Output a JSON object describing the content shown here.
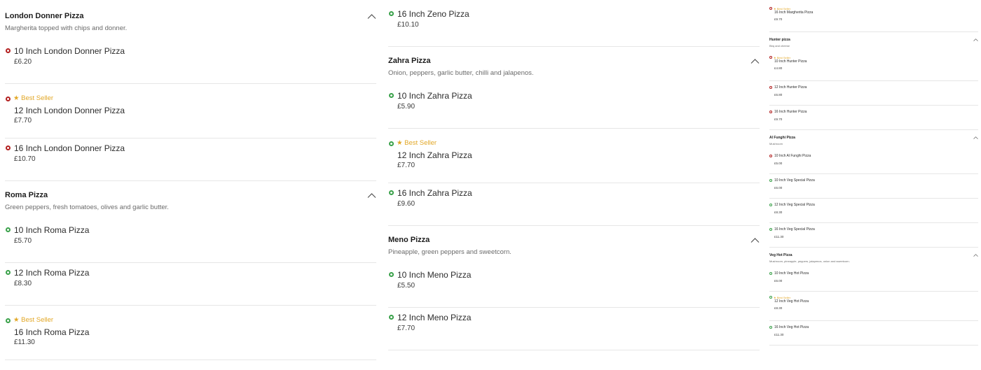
{
  "colors": {
    "veg": "#3aa14a",
    "nonveg": "#b32020",
    "bestseller": "#e2a726"
  },
  "columns": [
    [
      {
        "title": "London Donner Pizza",
        "desc": "Margherita topped with chips and donner.",
        "items": [
          {
            "name": "10 Inch London Donner Pizza",
            "price": "£6.20",
            "veg": false,
            "best": false
          },
          {
            "name": "12 Inch London Donner Pizza",
            "price": "£7.70",
            "veg": false,
            "best": true
          },
          {
            "name": "16 Inch London Donner Pizza",
            "price": "£10.70",
            "veg": false,
            "best": false
          }
        ]
      },
      {
        "title": "Roma Pizza",
        "desc": "Green peppers, fresh tomatoes, olives and garlic butter.",
        "items": [
          {
            "name": "10 Inch Roma Pizza",
            "price": "£5.70",
            "veg": true,
            "best": false
          },
          {
            "name": "12 Inch Roma Pizza",
            "price": "£8.30",
            "veg": true,
            "best": false
          },
          {
            "name": "16 Inch Roma Pizza",
            "price": "£11.30",
            "veg": true,
            "best": true
          }
        ]
      }
    ],
    [
      {
        "title": "",
        "desc": "",
        "items": [
          {
            "name": "16 Inch Zeno Pizza",
            "price": "£10.10",
            "veg": true,
            "best": false
          }
        ]
      },
      {
        "title": "Zahra Pizza",
        "desc": "Onion, peppers, garlic butter, chilli and jalapenos.",
        "items": [
          {
            "name": "10 Inch Zahra Pizza",
            "price": "£5.90",
            "veg": true,
            "best": false
          },
          {
            "name": "12 Inch Zahra Pizza",
            "price": "£7.70",
            "veg": true,
            "best": true
          },
          {
            "name": "16 Inch Zahra Pizza",
            "price": "£9.60",
            "veg": true,
            "best": false
          }
        ]
      },
      {
        "title": "Meno Pizza",
        "desc": "Pineapple, green peppers and sweetcorn.",
        "items": [
          {
            "name": "10 Inch Meno Pizza",
            "price": "£5.50",
            "veg": true,
            "best": false
          },
          {
            "name": "12 Inch Meno Pizza",
            "price": "£7.70",
            "veg": true,
            "best": false
          }
        ]
      }
    ],
    [
      {
        "title": "",
        "desc": "",
        "items": [
          {
            "name": "16 Inch Margherita Pizza",
            "price": "£9.70",
            "veg": false,
            "best": true
          }
        ]
      },
      {
        "title": "Hunter pizza",
        "desc": "Bbq and cheese",
        "items": [
          {
            "name": "10 Inch Hunter Pizza",
            "price": "£4.80",
            "veg": false,
            "best": true
          },
          {
            "name": "12 Inch Hunter Pizza",
            "price": "£6.80",
            "veg": false,
            "best": false
          },
          {
            "name": "16 Inch Hunter Pizza",
            "price": "£9.70",
            "veg": false,
            "best": false
          }
        ]
      },
      {
        "title": "Al Funghi Pizza",
        "desc": "Mushroom",
        "items": [
          {
            "name": "10 Inch Al Funghi Pizza",
            "price": "£5.00",
            "veg": false,
            "best": false
          },
          {
            "name": "10 Inch Veg Special Pizza",
            "price": "£6.00",
            "veg": true,
            "best": false
          },
          {
            "name": "12 Inch Veg Special Pizza",
            "price": "£8.30",
            "veg": true,
            "best": false
          },
          {
            "name": "16 Inch Veg Special Pizza",
            "price": "£11.30",
            "veg": true,
            "best": false
          }
        ]
      },
      {
        "title": "Veg Hot Pizza",
        "desc": "Mushroom, pineapple, peppers, jalapenos, onion and sweetcorn.",
        "items": [
          {
            "name": "10 Inch Veg Hot Pizza",
            "price": "£6.00",
            "veg": true,
            "best": false
          },
          {
            "name": "12 Inch Veg Hot Pizza",
            "price": "£8.30",
            "veg": true,
            "best": true
          },
          {
            "name": "16 Inch Veg Hot Pizza",
            "price": "£11.30",
            "veg": true,
            "best": false
          }
        ]
      }
    ]
  ],
  "best_seller_label": "Best Seller"
}
